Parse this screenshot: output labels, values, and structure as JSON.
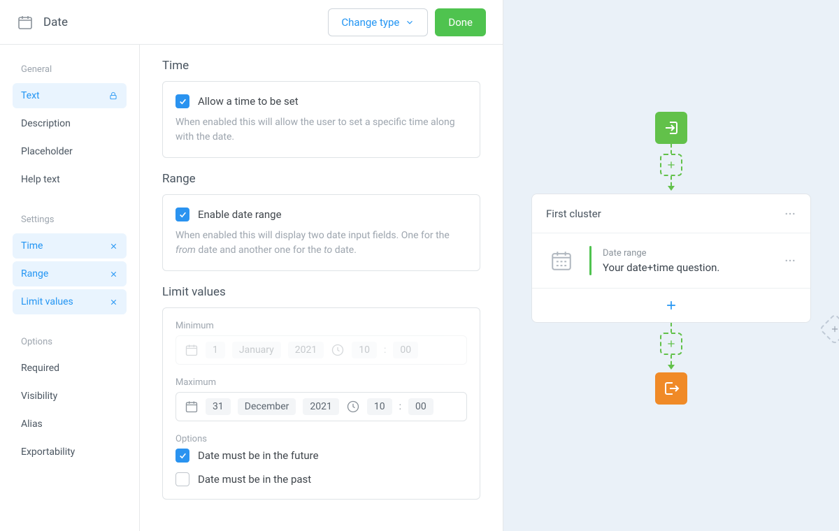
{
  "header": {
    "type_name": "Date",
    "change_type_label": "Change type",
    "done_label": "Done"
  },
  "sidebar": {
    "groups": [
      {
        "title": "General",
        "items": [
          {
            "label": "Text",
            "trailing_icon": "lock-icon",
            "active": true
          },
          {
            "label": "Description",
            "trailing_icon": null,
            "active": false
          },
          {
            "label": "Placeholder",
            "trailing_icon": null,
            "active": false
          },
          {
            "label": "Help text",
            "trailing_icon": null,
            "active": false
          }
        ]
      },
      {
        "title": "Settings",
        "items": [
          {
            "label": "Time",
            "trailing_icon": "close-icon",
            "active": true
          },
          {
            "label": "Range",
            "trailing_icon": "close-icon",
            "active": true
          },
          {
            "label": "Limit values",
            "trailing_icon": "close-icon",
            "active": true
          }
        ]
      },
      {
        "title": "Options",
        "items": [
          {
            "label": "Required",
            "trailing_icon": null,
            "active": false
          },
          {
            "label": "Visibility",
            "trailing_icon": null,
            "active": false
          },
          {
            "label": "Alias",
            "trailing_icon": null,
            "active": false
          },
          {
            "label": "Exportability",
            "trailing_icon": null,
            "active": false
          }
        ]
      }
    ]
  },
  "time_section": {
    "heading": "Time",
    "checkbox_label": "Allow a time to be set",
    "checked": true,
    "help": "When enabled this will allow the user to set a specific time along with the date."
  },
  "range_section": {
    "heading": "Range",
    "checkbox_label": "Enable date range",
    "checked": true,
    "help_prefix": "When enabled this will display two date input fields. One for the ",
    "help_from": "from",
    "help_mid": " date and another one for the ",
    "help_to": "to",
    "help_suffix": " date."
  },
  "limit_section": {
    "heading": "Limit values",
    "min_label": "Minimum",
    "max_label": "Maximum",
    "min": {
      "day": "1",
      "month": "January",
      "year": "2021",
      "hour": "10",
      "minute": "00"
    },
    "max": {
      "day": "31",
      "month": "December",
      "year": "2021",
      "hour": "10",
      "minute": "00"
    },
    "options_label": "Options",
    "future_label": "Date must be in the future",
    "past_label": "Date must be in the past",
    "future_checked": true,
    "past_checked": false
  },
  "preview": {
    "cluster_title": "First cluster",
    "item_subtitle": "Date range",
    "item_title": "Your date+time question."
  }
}
